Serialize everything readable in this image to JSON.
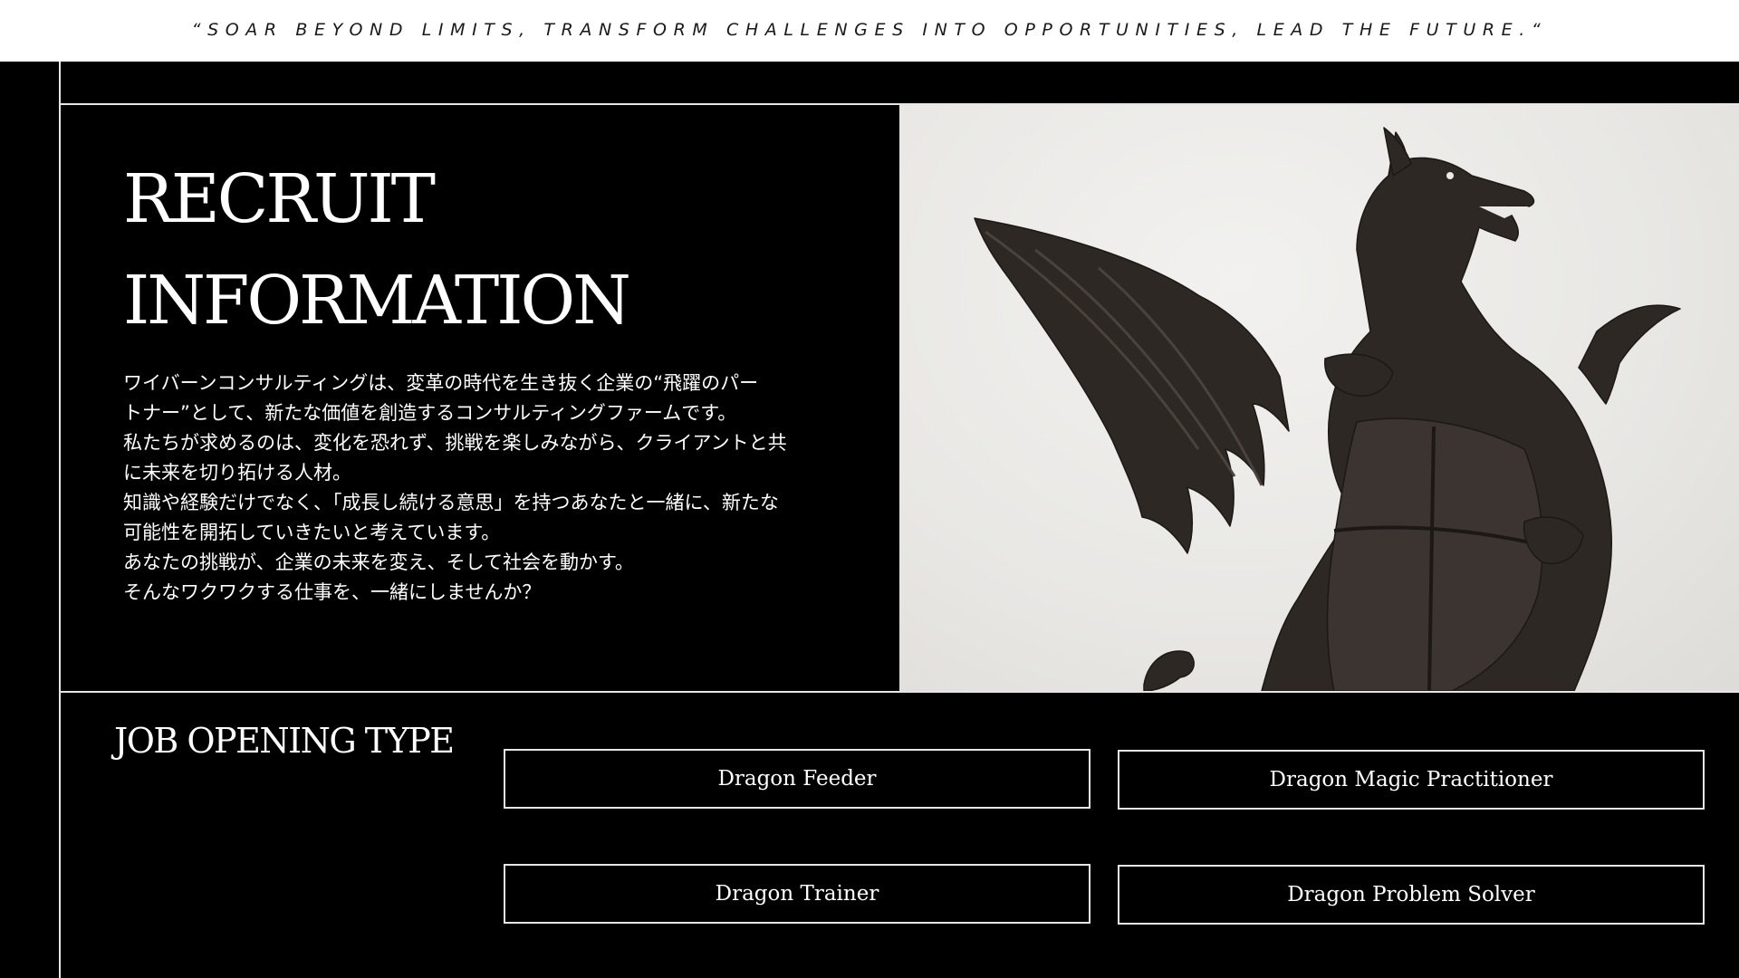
{
  "header": {
    "tagline": "“SOAR BEYOND LIMITS, TRANSFORM CHALLENGES INTO OPPORTUNITIES, LEAD THE FUTURE.“"
  },
  "hero": {
    "title_line1": "RECRUIT",
    "title_line2": "INFORMATION",
    "image_subject": "dragon-statue",
    "intro_lines": [
      "ワイバーンコンサルティングは、変革の時代を生き抜く企業の“飛躍のパー",
      "トナー”として、新たな価値を創造するコンサルティングファームです。",
      "私たちが求めるのは、変化を恐れず、挑戦を楽しみながら、クライアントと共",
      "に未来を切り拓ける人材。",
      "知識や経験だけでなく、「成長し続ける意思」を持つあなたと一緒に、新たな",
      "可能性を開拓していきたいと考えています。",
      "あなたの挑戦が、企業の未来を変え、そして社会を動かす。",
      "そんなワクワクする仕事を、一緒にしませんか？"
    ]
  },
  "jobs": {
    "heading": "JOB OPENING TYPE",
    "items": [
      {
        "label": "Dragon Feeder"
      },
      {
        "label": "Dragon Magic Practitioner"
      },
      {
        "label": "Dragon Trainer"
      },
      {
        "label": "Dragon Problem Solver"
      }
    ]
  },
  "colors": {
    "background": "#000000",
    "header_bg": "#ffffff",
    "rule": "#e6e6e6",
    "text": "#ffffff",
    "photo_bg": "#ebeae7",
    "statue": "#2e2824"
  }
}
